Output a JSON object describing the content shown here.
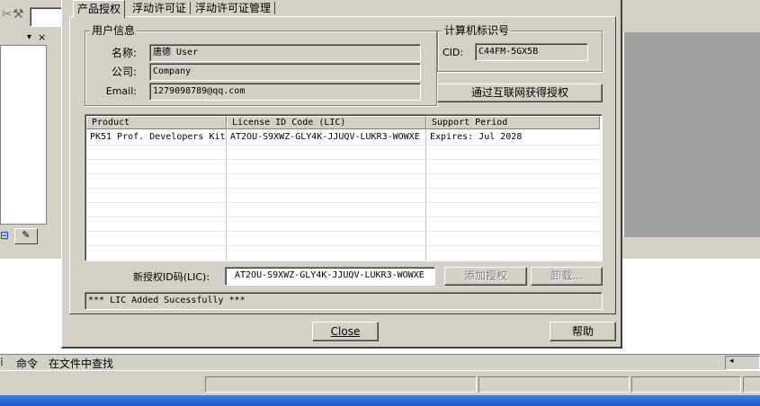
{
  "ide": {
    "bottom_tabs": [
      "命令",
      "在文件中查找"
    ],
    "left_panel_buttons": [
      "▾",
      "×"
    ]
  },
  "dialog": {
    "tabs": [
      "产品授权",
      "浮动许可证",
      "浮动许可证管理"
    ],
    "user_info": {
      "legend": "用户信息",
      "name_label": "名称:",
      "name_value": "唐德 User",
      "company_label": "公司:",
      "company_value": "Company",
      "email_label": "Email:",
      "email_value": "1279098789@qq.com"
    },
    "computer_id": {
      "legend": "计算机标识号",
      "cid_label": "CID:",
      "cid_value": "C44FM-5GX5B"
    },
    "get_license_button": "通过互联网获得授权",
    "license_table": {
      "columns": [
        "Product",
        "License ID Code (LIC)",
        "Support Period"
      ],
      "rows": [
        [
          "PK51 Prof. Developers Kit",
          "AT2OU-S9XWZ-GLY4K-JJUQV-LUKR3-WOWXE",
          "Expires: Jul 2028"
        ]
      ]
    },
    "new_lic_label": "新授权ID码(LIC):",
    "new_lic_value": "AT2OU-S9XWZ-GLY4K-JJUQV-LUKR3-WOWXE",
    "add_lic_button": "添加授权",
    "uninstall_button": "卸载...",
    "status_message": "*** LIC Added Sucessfully ***",
    "close_button": "Close",
    "help_button": "帮助"
  }
}
